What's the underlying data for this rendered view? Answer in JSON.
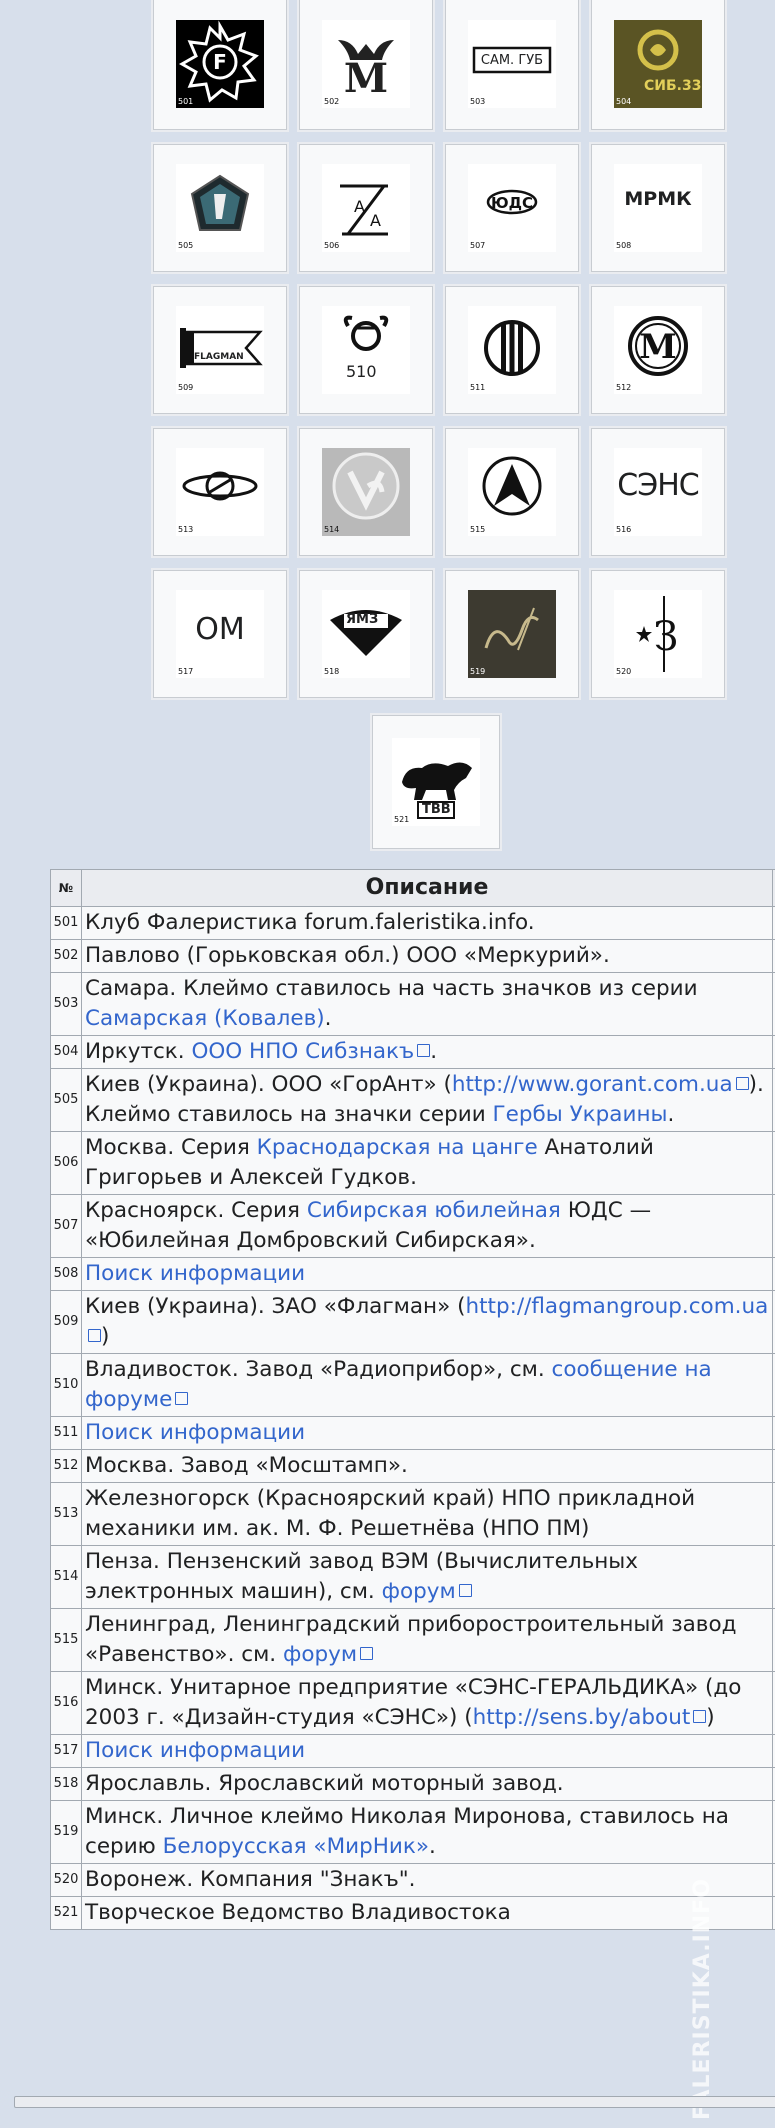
{
  "gallery": [
    {
      "num": "501",
      "icon": "star-f-badge-icon"
    },
    {
      "num": "502",
      "icon": "winged-m-icon"
    },
    {
      "num": "503",
      "icon": "sam-gub-box-icon",
      "text": "САМ. ГУБ"
    },
    {
      "num": "504",
      "icon": "golden-s-mark-icon",
      "text": "СИБ.33"
    },
    {
      "num": "505",
      "icon": "pentagon-shield-icon"
    },
    {
      "num": "506",
      "icon": "ga-mark-icon"
    },
    {
      "num": "507",
      "icon": "uds-oval-icon"
    },
    {
      "num": "508",
      "icon": "mrmk-text-icon",
      "text": "МРМК"
    },
    {
      "num": "509",
      "icon": "flagman-flag-icon",
      "text": "FLAGMAN"
    },
    {
      "num": "510",
      "icon": "radio-symbol-icon"
    },
    {
      "num": "511",
      "icon": "circle-bars-icon"
    },
    {
      "num": "512",
      "icon": "circle-m-icon"
    },
    {
      "num": "513",
      "icon": "ellipse-orbit-icon"
    },
    {
      "num": "514",
      "icon": "embossed-coin-icon"
    },
    {
      "num": "515",
      "icon": "circle-triangle-icon"
    },
    {
      "num": "516",
      "icon": "sens-text-icon",
      "text": "СЭНС"
    },
    {
      "num": "517",
      "icon": "om-text-icon",
      "text": "ОМ"
    },
    {
      "num": "518",
      "icon": "ymz-badge-icon",
      "text": "ЯМЗ"
    },
    {
      "num": "519",
      "icon": "signature-mark-icon"
    },
    {
      "num": "520",
      "icon": "star-z-icon"
    },
    {
      "num": "521",
      "icon": "tiger-tvv-icon",
      "text": "ТВВ"
    }
  ],
  "table": {
    "headers": {
      "num": "№",
      "desc": "Описание"
    },
    "rows": {
      "r501": {
        "n": "501",
        "t1": "Клуб Фалеристика forum.faleristika.info.",
        "x": "4"
      },
      "r502": {
        "n": "502",
        "t1": "Павлово (Горьковская обл.) ООО «Меркурий».",
        "x": "0"
      },
      "r503": {
        "n": "503",
        "t1": "Самара. Клеймо ставилось на часть значков из серии ",
        "l1": "Самарская (Ковалев)",
        "t2": ".",
        "x": "1"
      },
      "r504": {
        "n": "504",
        "t1": "Иркутск. ",
        "l1": "ООО НПО Сибзнакъ",
        "t2": ".",
        "x": "8"
      },
      "r505": {
        "n": "505",
        "t1": "Киев (Украина). ООО «ГорАнт» (",
        "l1": "http://www.gorant.com.ua",
        "t2": "). Клеймо ставилось на значки серии ",
        "l2": "Гербы Украины",
        "t3": ".",
        "x": "2"
      },
      "r506": {
        "n": "506",
        "t1": "Москва. Серия ",
        "l1": "Краснодарская на цанге",
        "t2": " Анатолий Григорьев и Алексей Гудков.",
        "x": "5"
      },
      "r507": {
        "n": "507",
        "t1": "Красноярск. Серия ",
        "l1": "Сибирская юбилейная",
        "t2": " ЮДС — «Юбилейная Домбровский Сибирская».",
        "x": "1"
      },
      "r508": {
        "n": "508",
        "l1": "Поиск информации",
        "x": "2"
      },
      "r509": {
        "n": "509",
        "t1": "Киев (Украина). ЗАО «Флагман» (",
        "l1": "http://flagmangroup.com.ua",
        "t2": ")",
        "x": "1"
      },
      "r510": {
        "n": "510",
        "t1": "Владивосток. Завод «Радиоприбор», см. ",
        "l1": "сообщение на форуме",
        "x": "1"
      },
      "r511": {
        "n": "511",
        "l1": "Поиск информации",
        "x": "1"
      },
      "r512": {
        "n": "512",
        "t1": "Москва. Завод «Мосштамп».",
        "x": "1"
      },
      "r513": {
        "n": "513",
        "t1": "Железногорск (Красноярский край) НПО прикладной механики им. ак. М. Ф. Решетнёва (НПО ПМ)",
        "x": "1"
      },
      "r514": {
        "n": "514",
        "t1": "Пенза. Пензенский завод ВЭМ (Вычислительных электронных машин), см. ",
        "l1": "форум",
        "x": "1"
      },
      "r515": {
        "n": "515",
        "t1": "Ленинград, Ленинградский приборостроительный завод «Равенство». см. ",
        "l1": "форум",
        "x": "0"
      },
      "r516": {
        "n": "516",
        "t1": "Минск. Унитарное предприятие «СЭНС-ГЕРАЛЬДИКА» (до 2003 г. «Дизайн-студия «СЭНС») (",
        "l1": "http://sens.by/about",
        "t2": ")",
        "x": "1"
      },
      "r517": {
        "n": "517",
        "l1": "Поиск информации",
        "x": "1"
      },
      "r518": {
        "n": "518",
        "t1": "Ярославль. Ярославский моторный завод.",
        "x": "1"
      },
      "r519": {
        "n": "519",
        "t1": "Минск. Личное клеймо Николая Миронова, ставилось на серию ",
        "l1": "Белорусская «МирНик»",
        "t2": ".",
        "x": "1"
      },
      "r520": {
        "n": "520",
        "t1": "Воронеж. Компания \"Знакъ\".",
        "x": "0"
      },
      "r521": {
        "n": "521",
        "t1": "Творческое Ведомство Владивостока",
        "x": "0"
      }
    }
  },
  "watermark": "FALERISTIKA.INFO"
}
